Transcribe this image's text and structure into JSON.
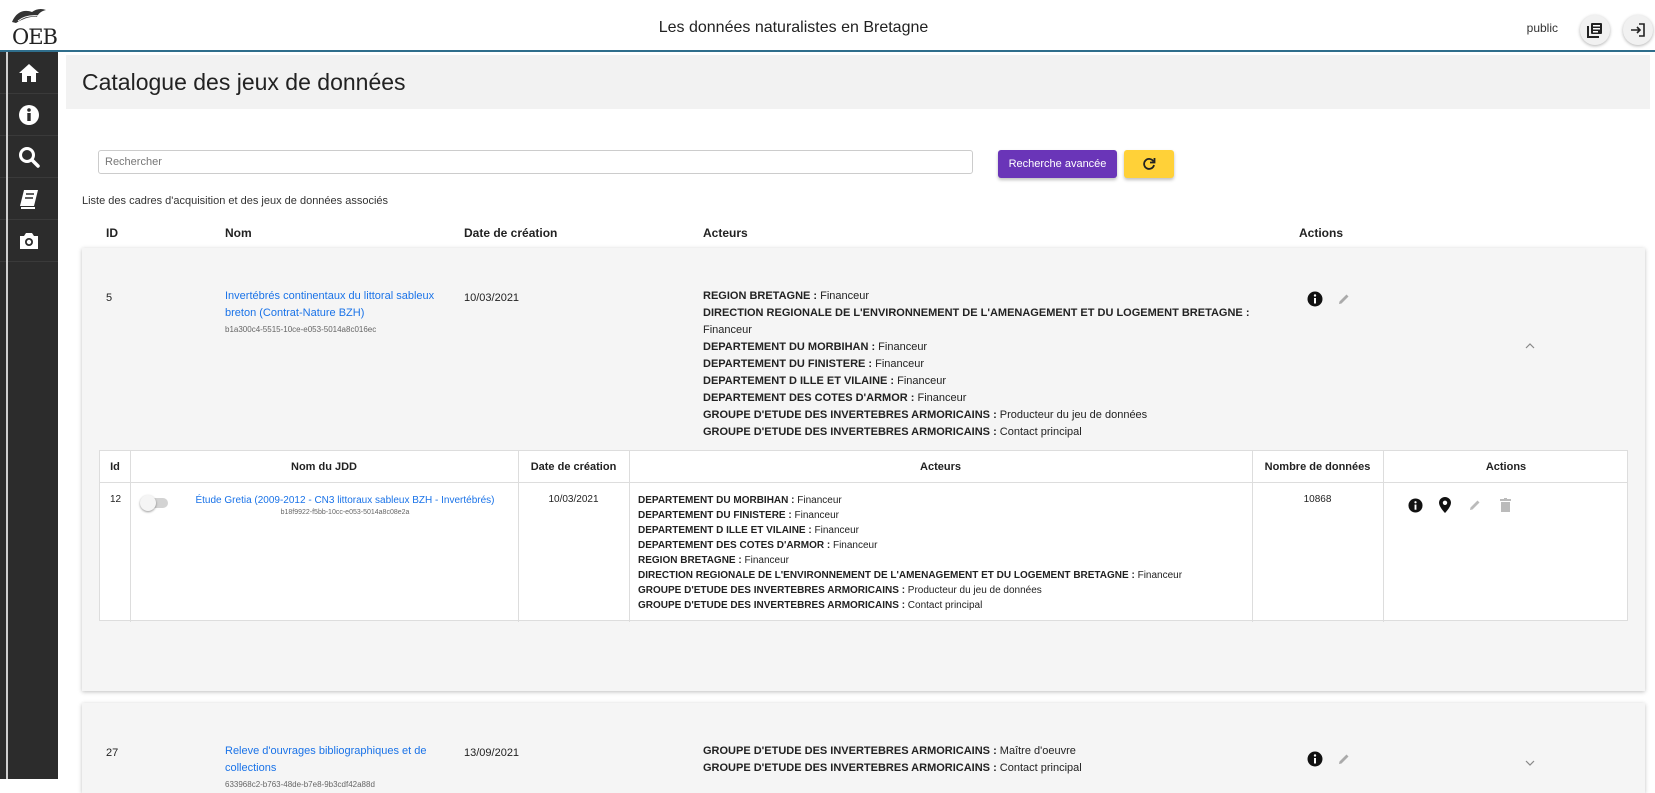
{
  "header": {
    "logo_text": "OEB",
    "title": "Les données naturalistes en Bretagne",
    "user": "public",
    "buttons": [
      {
        "icon": "library-books-icon"
      },
      {
        "icon": "logout-icon"
      }
    ]
  },
  "sidebar": {
    "items": [
      {
        "icon": "home-icon"
      },
      {
        "icon": "info-icon"
      },
      {
        "icon": "search-icon"
      },
      {
        "icon": "book-icon"
      },
      {
        "icon": "camera-icon"
      }
    ]
  },
  "page": {
    "title": "Catalogue des jeux de données",
    "search_placeholder": "Rechercher",
    "advanced_search_label": "Recherche avancée",
    "refresh_icon": "refresh-icon",
    "list_caption": "Liste des cadres d'acquisition et des jeux de données associés",
    "columns": {
      "id": "ID",
      "name": "Nom",
      "date": "Date de création",
      "actors": "Acteurs",
      "actions": "Actions"
    }
  },
  "frameworks": [
    {
      "id": "5",
      "name": "Invertébrés continentaux du littoral sableux breton (Contrat-Nature BZH)",
      "uuid": "b1a300c4-5515-10ce-e053-5014a8c016ec",
      "date": "10/03/2021",
      "actors": [
        {
          "org": "REGION BRETAGNE :",
          "role": " Financeur"
        },
        {
          "org": "DIRECTION REGIONALE DE L'ENVIRONNEMENT DE L'AMENAGEMENT ET DU LOGEMENT BRETAGNE :",
          "role": " Financeur"
        },
        {
          "org": "DEPARTEMENT DU MORBIHAN :",
          "role": " Financeur"
        },
        {
          "org": "DEPARTEMENT DU FINISTERE :",
          "role": " Financeur"
        },
        {
          "org": "DEPARTEMENT D ILLE ET VILAINE :",
          "role": " Financeur"
        },
        {
          "org": "DEPARTEMENT DES COTES D'ARMOR :",
          "role": " Financeur"
        },
        {
          "org": "GROUPE D'ETUDE DES INVERTEBRES ARMORICAINS :",
          "role": " Producteur du jeu de données"
        },
        {
          "org": "GROUPE D'ETUDE DES INVERTEBRES ARMORICAINS :",
          "role": " Contact principal"
        }
      ],
      "datasets_table": {
        "headers": {
          "id": "Id",
          "name": "Nom du JDD",
          "date": "Date de création",
          "actors": "Acteurs",
          "count": "Nombre de données",
          "actions": "Actions"
        },
        "rows": [
          {
            "id": "12",
            "name": "Étude Gretia (2009-2012 - CN3 littoraux sableux BZH - Invertébrés)",
            "uuid": "b18f9922-f5bb-10cc-e053-5014a8c08e2a",
            "date": "10/03/2021",
            "count": "10868",
            "actors": [
              {
                "org": "DEPARTEMENT DU MORBIHAN :",
                "role": " Financeur"
              },
              {
                "org": "DEPARTEMENT DU FINISTERE :",
                "role": " Financeur"
              },
              {
                "org": "DEPARTEMENT D ILLE ET VILAINE :",
                "role": " Financeur"
              },
              {
                "org": "DEPARTEMENT DES COTES D'ARMOR :",
                "role": " Financeur"
              },
              {
                "org": "REGION BRETAGNE :",
                "role": " Financeur"
              },
              {
                "org": "DIRECTION REGIONALE DE L'ENVIRONNEMENT DE L'AMENAGEMENT ET DU LOGEMENT BRETAGNE :",
                "role": " Financeur"
              },
              {
                "org": "GROUPE D'ETUDE DES INVERTEBRES ARMORICAINS :",
                "role": " Producteur du jeu de données"
              },
              {
                "org": "GROUPE D'ETUDE DES INVERTEBRES ARMORICAINS :",
                "role": " Contact principal"
              }
            ]
          }
        ]
      }
    },
    {
      "id": "27",
      "name": "Releve d'ouvrages bibliographiques et de collections",
      "uuid": "633968c2-b763-48de-b7e8-9b3cdf42a88d",
      "date": "13/09/2021",
      "actors": [
        {
          "org": "GROUPE D'ETUDE DES INVERTEBRES ARMORICAINS :",
          "role": " Maître d'oeuvre"
        },
        {
          "org": "GROUPE D'ETUDE DES INVERTEBRES ARMORICAINS :",
          "role": " Contact principal"
        }
      ]
    }
  ]
}
